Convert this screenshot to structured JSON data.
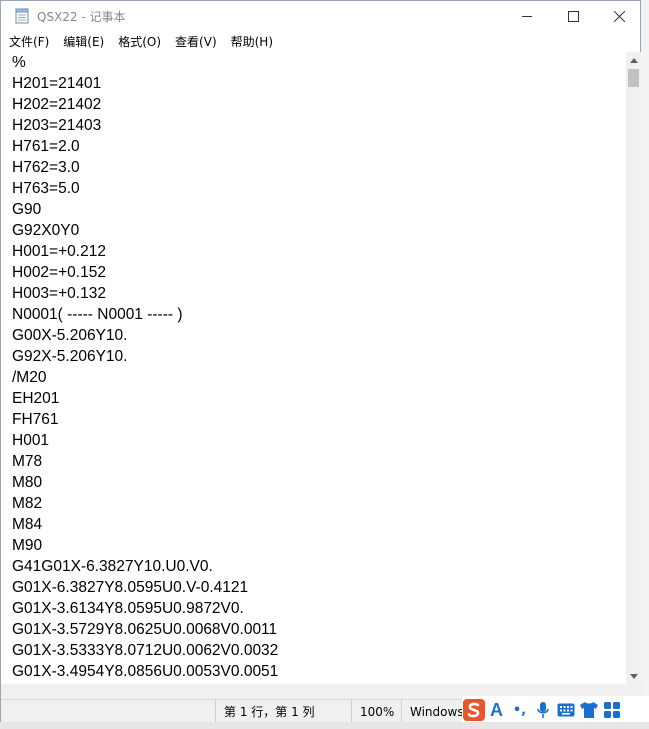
{
  "window": {
    "title": "QSX22 - 记事本"
  },
  "menu": [
    "文件(F)",
    "编辑(E)",
    "格式(O)",
    "查看(V)",
    "帮助(H)"
  ],
  "lines": [
    "%",
    "H201=21401",
    "H202=21402",
    "H203=21403",
    "H761=2.0",
    "H762=3.0",
    "H763=5.0",
    "G90",
    "G92X0Y0",
    "H001=+0.212",
    "H002=+0.152",
    "H003=+0.132",
    "N0001( ----- N0001 ----- )",
    "G00X-5.206Y10.",
    "G92X-5.206Y10.",
    "/M20",
    "EH201",
    "FH761",
    "H001",
    "M78",
    "M80",
    "M82",
    "M84",
    "M90",
    "G41G01X-6.3827Y10.U0.V0.",
    "G01X-6.3827Y8.0595U0.V-0.4121",
    "G01X-3.6134Y8.0595U0.9872V0.",
    "G01X-3.5729Y8.0625U0.0068V0.0011",
    "G01X-3.5333Y8.0712U0.0062V0.0032",
    "G01X-3.4954Y8.0856U0.0053V0.0051"
  ],
  "status": {
    "position": "第 1 行，第 1 列",
    "zoom": "100%",
    "line_ending": "Windows"
  },
  "ime": {
    "mode_label": "A",
    "punct_label": "•,"
  },
  "colors": {
    "ime_brand": "#e8572c",
    "ime_icon": "#1a6fd1"
  }
}
